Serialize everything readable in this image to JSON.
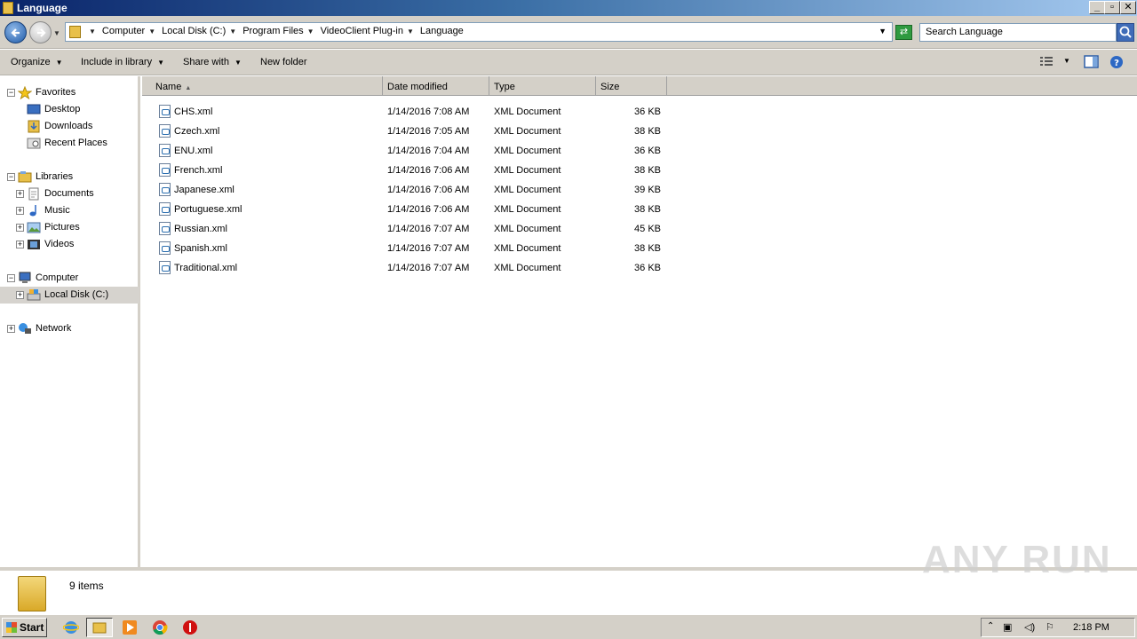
{
  "window": {
    "title": "Language",
    "minimize": "_",
    "maximize": "▫",
    "close": "✕"
  },
  "address": {
    "crumbs": [
      "Computer",
      "Local Disk (C:)",
      "Program Files",
      "VideoClient Plug-in",
      "Language"
    ],
    "search_placeholder": "Search Language"
  },
  "toolbar": {
    "organize": "Organize",
    "include_in_library": "Include in library",
    "share_with": "Share with",
    "new_folder": "New folder"
  },
  "nav": {
    "favorites": "Favorites",
    "desktop": "Desktop",
    "downloads": "Downloads",
    "recent_places": "Recent Places",
    "libraries": "Libraries",
    "documents": "Documents",
    "music": "Music",
    "pictures": "Pictures",
    "videos": "Videos",
    "computer": "Computer",
    "local_disk": "Local Disk (C:)",
    "network": "Network"
  },
  "columns": {
    "name": "Name",
    "date_modified": "Date modified",
    "type": "Type",
    "size": "Size"
  },
  "files": [
    {
      "name": "CHS.xml",
      "date": "1/14/2016 7:08 AM",
      "type": "XML Document",
      "size": "36 KB"
    },
    {
      "name": "Czech.xml",
      "date": "1/14/2016 7:05 AM",
      "type": "XML Document",
      "size": "38 KB"
    },
    {
      "name": "ENU.xml",
      "date": "1/14/2016 7:04 AM",
      "type": "XML Document",
      "size": "36 KB"
    },
    {
      "name": "French.xml",
      "date": "1/14/2016 7:06 AM",
      "type": "XML Document",
      "size": "38 KB"
    },
    {
      "name": "Japanese.xml",
      "date": "1/14/2016 7:06 AM",
      "type": "XML Document",
      "size": "39 KB"
    },
    {
      "name": "Portuguese.xml",
      "date": "1/14/2016 7:06 AM",
      "type": "XML Document",
      "size": "38 KB"
    },
    {
      "name": "Russian.xml",
      "date": "1/14/2016 7:07 AM",
      "type": "XML Document",
      "size": "45 KB"
    },
    {
      "name": "Spanish.xml",
      "date": "1/14/2016 7:07 AM",
      "type": "XML Document",
      "size": "38 KB"
    },
    {
      "name": "Traditional.xml",
      "date": "1/14/2016 7:07 AM",
      "type": "XML Document",
      "size": "36 KB"
    }
  ],
  "status": {
    "item_count": "9 items"
  },
  "watermark": "ANY RUN",
  "taskbar": {
    "start": "Start",
    "clock": "2:18 PM"
  }
}
